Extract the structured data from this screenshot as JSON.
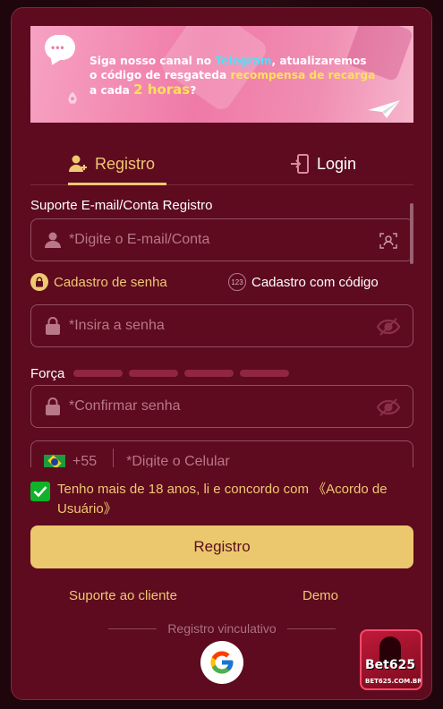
{
  "banner": {
    "line1_pre": "Siga nosso canal no ",
    "line1_highlight": "Telegram",
    "line1_post": ", atualizaremos",
    "line2_pre": "o código de resgateda ",
    "line2_highlight": "recompensa de recarga",
    "line3_pre": "a cada ",
    "line3_highlight": "2 horas",
    "line3_post": "?"
  },
  "tabs": {
    "register": "Registro",
    "login": "Login"
  },
  "form": {
    "email_section_label": "Suporte E-mail/Conta Registro",
    "email_placeholder": "*Digite o E-mail/Conta",
    "mode_password": "Cadastro de senha",
    "mode_code": "Cadastro com código",
    "mode_code_badge": "123",
    "password_placeholder": "*Insira a senha",
    "strength_label": "Força",
    "confirm_placeholder": "*Confirmar senha",
    "phone_code": "+55",
    "phone_placeholder": "*Digite o Celular",
    "agree_text": "Tenho mais de 18 anos, li e concordo com ",
    "agree_link": "《Acordo de Usuário》",
    "agree_checked": true,
    "submit_label": "Registro"
  },
  "links": {
    "support": "Suporte ao cliente",
    "demo": "Demo"
  },
  "social": {
    "divider_label": "Registro vinculativo",
    "google_icon": "google-icon"
  },
  "app_badge": {
    "logo": "Bet625",
    "site": "BET625.COM.BR"
  },
  "colors": {
    "modal_bg": "#5e0a1f",
    "accent_gold": "#efc873",
    "button_gold": "#ebc86d",
    "placeholder": "#b97887",
    "check_green": "#10b22a"
  }
}
